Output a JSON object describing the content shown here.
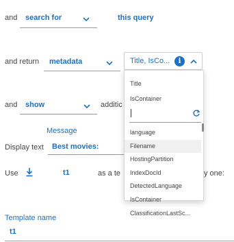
{
  "row1": {
    "prefix": "and",
    "verb": "search for",
    "object": "this query"
  },
  "row2": {
    "prefix": "and return",
    "return_type": "metadata",
    "fields_value": "Title, IsCo..."
  },
  "row3": {
    "prefix": "and",
    "show_value": "show",
    "suffix_visible": "additic"
  },
  "row4": {
    "message_label": "Message",
    "display_label": "Display text",
    "display_value": "Best movies:"
  },
  "row5": {
    "prefix": "Use",
    "template": "t1",
    "mid_text_visible": "as a te",
    "suffix_visible": "y one:"
  },
  "row6": {
    "template_name_label": "Template name",
    "template_name_value": "t1"
  },
  "popup": {
    "selected": [
      "Title",
      "IsContainer"
    ],
    "search_value": "",
    "items": [
      "language",
      "Filename",
      "HostingPartition",
      "IndexDocId",
      "DetectedLanguage",
      "IsContainer",
      "ClassificationLastSc..."
    ],
    "highlighted_index": 1
  },
  "colors": {
    "accent": "#1e6fbf",
    "text": "#444444",
    "underline": "#9a9a9a"
  },
  "icons": {
    "download": "download-icon",
    "info": "info-icon",
    "refresh": "refresh-icon",
    "chevron_down": "chevron-down-icon",
    "chevron_up": "chevron-up-icon"
  }
}
